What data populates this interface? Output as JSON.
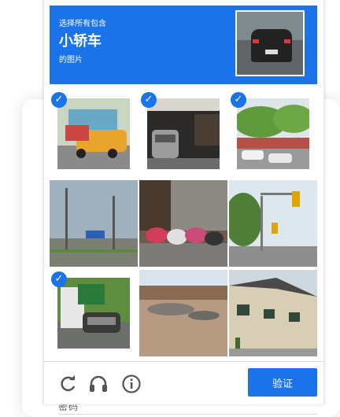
{
  "page": {
    "bg_field_label": "密码"
  },
  "captcha": {
    "instruction_line1": "选择所有包含",
    "instruction_target": "小轿车",
    "instruction_line3": "的图片",
    "sample_icon": "car-sample-image",
    "tiles": [
      {
        "index": 1,
        "description": "colorful bus",
        "selected": true
      },
      {
        "index": 2,
        "description": "car in garage",
        "selected": true
      },
      {
        "index": 3,
        "description": "parked cars with trees",
        "selected": true
      },
      {
        "index": 4,
        "description": "road with street lamps and sign",
        "selected": false
      },
      {
        "index": 5,
        "description": "motorcycles in front of shutter",
        "selected": false
      },
      {
        "index": 6,
        "description": "street with traffic light",
        "selected": false
      },
      {
        "index": 7,
        "description": "truck and car on road",
        "selected": true
      },
      {
        "index": 8,
        "description": "dirt lot with rubble",
        "selected": false
      },
      {
        "index": 9,
        "description": "residential building",
        "selected": false
      }
    ],
    "verify_label": "验证",
    "icons": [
      "reload-icon",
      "audio-icon",
      "info-icon"
    ],
    "accent": "#1a73e8"
  }
}
